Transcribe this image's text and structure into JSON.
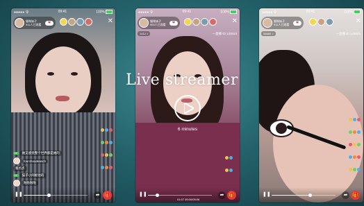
{
  "overlay": {
    "title": "Live streamer",
    "duration": "6 minutes",
    "play_icon": "play-icon"
  },
  "colors": {
    "gift": "#e8383d",
    "badge_green": "#4cc25a",
    "battery": "#3dd45a"
  },
  "phones": [
    {
      "status": {
        "signal": "●●●●● 令",
        "time": "09:41",
        "battery": "100%"
      },
      "host": {
        "name": "猫咪妹子",
        "sub": "911人已观看",
        "follow_label": "❤"
      },
      "fans_badge": "",
      "room_id": "",
      "chat": [
        {
          "level": "",
          "text": "她又感觉整个世界都是她的"
        },
        {
          "level": "",
          "text": "fourchoudeasch"
        },
        {
          "level": "",
          "text": "看点点"
        },
        {
          "level": "",
          "text": "猫子小闹妮他的"
        },
        {
          "level": "",
          "text": "啦啦啦啦"
        }
      ],
      "progress": 0.4,
      "time_text": ""
    },
    {
      "status": {
        "signal": "●●●●● 令",
        "time": "09:41",
        "battery": "100%"
      },
      "host": {
        "name": "猫咪妹子",
        "sub": "900人已观看",
        "follow_label": "❤"
      },
      "fans_badge": "1412 >",
      "room_id": "一直播 ID:143523",
      "chat": [],
      "progress": 0.15,
      "time_text": "01:07 05:00/05:06"
    },
    {
      "status": {
        "signal": "●●●●● 令",
        "time": "09:41",
        "battery": "100%"
      },
      "host": {
        "name": "猫咪妹子",
        "sub": "911人已观看",
        "follow_label": "❤"
      },
      "fans_badge": "55680 >",
      "room_id": "一直播 ID:143523",
      "chat": [],
      "progress": 0.6,
      "time_text": ""
    }
  ]
}
